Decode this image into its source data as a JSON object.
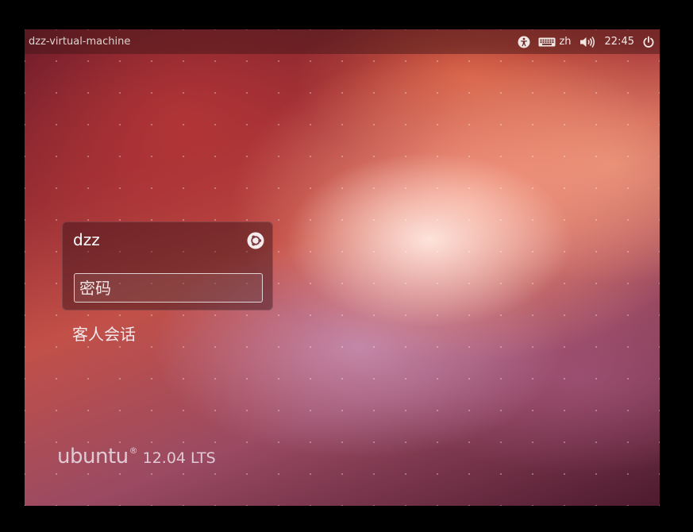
{
  "panel": {
    "hostname": "dzz-virtual-machine",
    "keyboard_layout": "zh",
    "clock": "22:45",
    "icons": [
      "accessibility-icon",
      "keyboard-icon",
      "volume-icon",
      "power-icon"
    ]
  },
  "login": {
    "username": "dzz",
    "password_placeholder": "密码",
    "session_icon": "ubuntu-session-icon"
  },
  "guest": {
    "label": "客人会话"
  },
  "branding": {
    "name": "ubuntu",
    "registered": "®",
    "version": "12.04 LTS"
  }
}
